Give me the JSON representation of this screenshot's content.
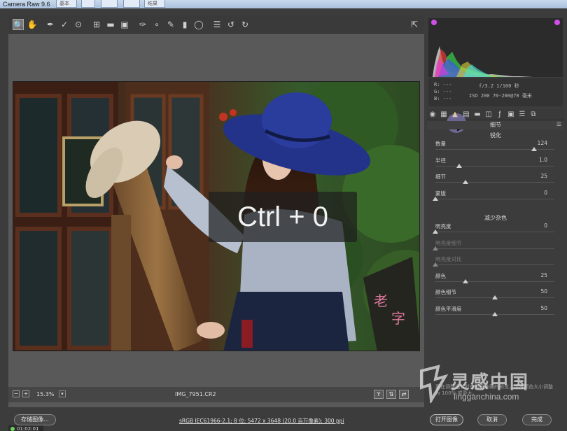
{
  "window": {
    "title": "Camera Raw 9.6",
    "fake_tabs": [
      "基本",
      "",
      "",
      "",
      "结果"
    ]
  },
  "toolbar": {
    "tools": [
      "zoom-icon",
      "hand-icon",
      "white-balance-icon",
      "color-sampler-icon",
      "target-adjust-icon",
      "crop-icon",
      "straighten-icon",
      "transform-icon",
      "spot-removal-icon",
      "red-eye-icon",
      "adjustment-brush-icon",
      "graduated-filter-icon",
      "radial-filter-icon",
      "presets-list-icon",
      "rotate-ccw-icon",
      "rotate-cw-icon"
    ],
    "export_icon": "export-icon"
  },
  "overlay": {
    "text": "Ctrl + 0"
  },
  "statusbar": {
    "zoom": "15.3%",
    "filename": "IMG_7951.CR2",
    "buttons": [
      "Y",
      "⇅",
      "⇄"
    ]
  },
  "exif": {
    "r": "R: ---",
    "g": "G: ---",
    "b": "B: ---",
    "line1": "f/3.2   1/100 秒",
    "line2": "ISO 200   70-200@70 毫米"
  },
  "panel": {
    "title": "细节",
    "sharpen_title": "锐化",
    "noise_title": "减少杂色",
    "sharpen": [
      {
        "label": "数量",
        "value": "124",
        "level": 0.83
      },
      {
        "label": "半径",
        "value": "1.0",
        "level": 0.2
      },
      {
        "label": "细节",
        "value": "25",
        "level": 0.25
      },
      {
        "label": "蒙版",
        "value": "0",
        "level": 0.0
      }
    ],
    "noise": [
      {
        "label": "明亮度",
        "value": "0",
        "level": 0.0,
        "disabled": false
      },
      {
        "label": "明亮度细节",
        "value": "",
        "level": 0.0,
        "disabled": true
      },
      {
        "label": "明亮度对比",
        "value": "",
        "level": 0.0,
        "disabled": true
      },
      {
        "label": "颜色",
        "value": "25",
        "level": 0.25,
        "disabled": false
      },
      {
        "label": "颜色细节",
        "value": "50",
        "level": 0.5,
        "disabled": false
      },
      {
        "label": "颜色平滑度",
        "value": "50",
        "level": 0.5,
        "disabled": false
      }
    ]
  },
  "watermark_note": "要在调整细节时查看更准确的预览，请将预览大小调整为 100% 或更大。",
  "bottom": {
    "save_label": "存储图像...",
    "info_link": "sRGB IEC61966-2.1; 8 位; 5472 x 3648 (20.0 百万像素); 300 ppi",
    "open_label": "打开图像",
    "cancel_label": "取消",
    "done_label": "完成",
    "timer": "01:02:01"
  },
  "logo": {
    "main": "灵感中国",
    "sub": "lingganchina.com"
  },
  "colors": {
    "accent_purple": "#c85ae0",
    "active_tab": "#ffe36b",
    "timer_dot": "#6bd15a"
  }
}
